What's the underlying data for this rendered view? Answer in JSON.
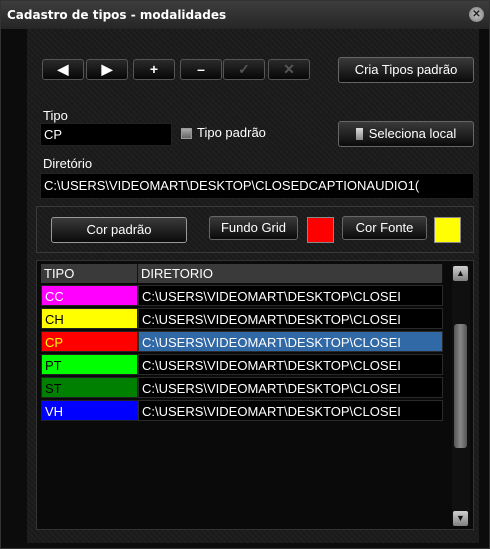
{
  "window": {
    "title": "Cadastro de tipos - modalidades",
    "close_glyph": "✕"
  },
  "toolbar": {
    "prev_glyph": "◀",
    "next_glyph": "▶",
    "add_glyph": "+",
    "remove_glyph": "–",
    "confirm_glyph": "✓",
    "cancel_glyph": "✕",
    "cria_label": "Cria Tipos padrão"
  },
  "form": {
    "tipo_label": "Tipo",
    "tipo_value": "CP",
    "tipo_padrao_label": "Tipo padrão",
    "seleciona_label": "Seleciona local",
    "diretorio_label": "Diretório",
    "diretorio_value": "C:\\USERS\\VIDEOMART\\DESKTOP\\CLOSEDCAPTIONAUDIO1("
  },
  "colors": {
    "cor_padrao_label": "Cor padrão",
    "fundo_grid_label": "Fundo Grid",
    "fundo_grid_color": "#ff0000",
    "cor_fonte_label": "Cor Fonte",
    "cor_fonte_color": "#ffff00"
  },
  "grid": {
    "columns": [
      "TIPO",
      "DIRETORIO"
    ],
    "rows": [
      {
        "tipo": "CC",
        "diretorio": "C:\\USERS\\VIDEOMART\\DESKTOP\\CLOSEI",
        "bg": "#ff00ff",
        "fg": "#ffffff"
      },
      {
        "tipo": "CH",
        "diretorio": "C:\\USERS\\VIDEOMART\\DESKTOP\\CLOSEI",
        "bg": "#ffff00",
        "fg": "#000000"
      },
      {
        "tipo": "CP",
        "diretorio": "C:\\USERS\\VIDEOMART\\DESKTOP\\CLOSEI",
        "bg": "#ff0000",
        "fg": "#ffff00"
      },
      {
        "tipo": "PT",
        "diretorio": "C:\\USERS\\VIDEOMART\\DESKTOP\\CLOSEI",
        "bg": "#00ff00",
        "fg": "#000000"
      },
      {
        "tipo": "ST",
        "diretorio": "C:\\USERS\\VIDEOMART\\DESKTOP\\CLOSEI",
        "bg": "#008000",
        "fg": "#000000"
      },
      {
        "tipo": "VH",
        "diretorio": "C:\\USERS\\VIDEOMART\\DESKTOP\\CLOSEI",
        "bg": "#0000ff",
        "fg": "#ffffff"
      }
    ],
    "selected_row": 2,
    "scroll_up_glyph": "▲",
    "scroll_down_glyph": "▼"
  }
}
